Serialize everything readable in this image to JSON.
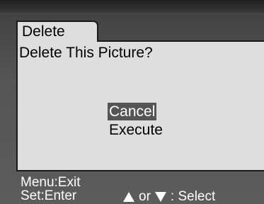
{
  "dialog": {
    "tab_title": "Delete",
    "prompt": "Delete This Picture?",
    "options": {
      "cancel": "Cancel",
      "execute": "Execute",
      "selected": "Cancel"
    }
  },
  "footer": {
    "menu_hint": "Menu:Exit",
    "set_hint": "Set:Enter",
    "or_text": "or",
    "select_text": ": Select",
    "up_icon": "triangle-up-icon",
    "down_icon": "triangle-down-icon"
  },
  "colors": {
    "panel_bg": "#dedede",
    "highlight_bg": "#555555",
    "screen_bg": "#5a5a5a",
    "footer_text": "#ffffff"
  }
}
